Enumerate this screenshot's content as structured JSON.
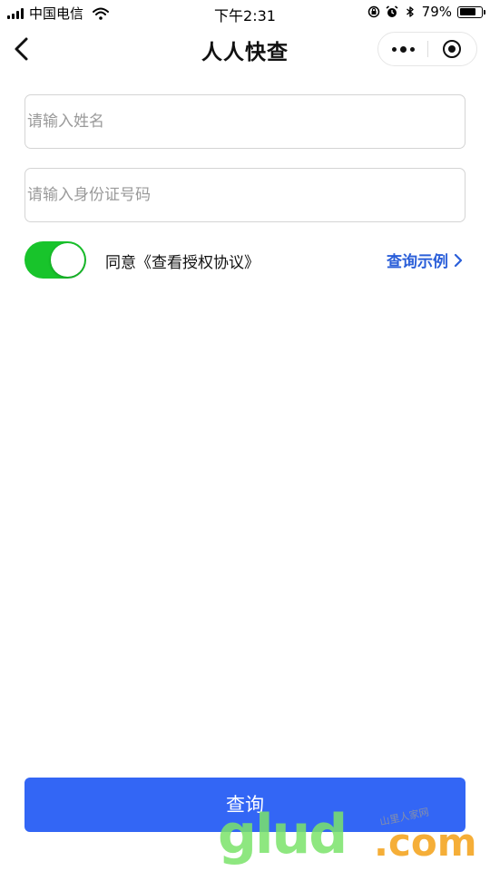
{
  "status_bar": {
    "carrier": "中国电信",
    "time": "下午2:31",
    "battery_percent": "79%",
    "battery_level": 0.79,
    "icons": [
      "signal-icon",
      "wifi-icon",
      "lock-rotation-icon",
      "alarm-icon",
      "bluetooth-icon",
      "battery-icon"
    ]
  },
  "nav": {
    "title": "人人快查",
    "back_icon": "chevron-left-icon",
    "more_icon": "more-dots-icon",
    "close_icon": "target-circle-icon"
  },
  "form": {
    "name_placeholder": "请输入姓名",
    "name_value": "",
    "id_placeholder": "请输入身份证号码",
    "id_value": "",
    "agree_toggle_on": true,
    "agree_text": "同意《查看授权协议》",
    "example_link": "查询示例"
  },
  "query_button": "查询",
  "watermark": {
    "main": "glud",
    "suffix": ".com",
    "small": "山里人家网"
  },
  "colors": {
    "toggle_on": "#18c42b",
    "link": "#2b5fd9",
    "button": "#3366f5",
    "watermark_green": "#7be36b",
    "watermark_orange": "#f5a623"
  }
}
